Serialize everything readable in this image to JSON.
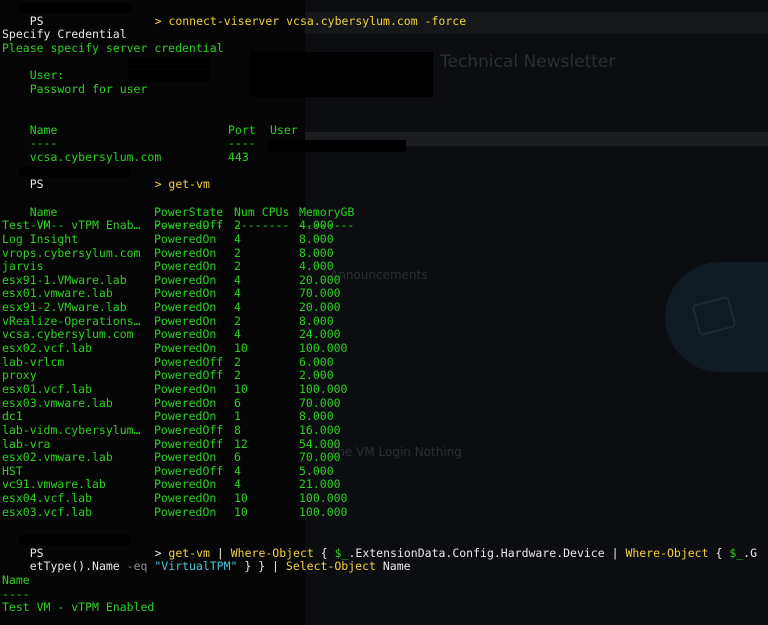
{
  "prompt": "PS",
  "cmd1": "> connect-viserver vcsa.cybersylum.com -force",
  "credential": {
    "header": "Specify Credential",
    "message": "Please specify server credential",
    "user_label": "User:",
    "password_label": "Password for user"
  },
  "connect_table": {
    "headers": {
      "name": "Name",
      "port": "Port",
      "user": "User"
    },
    "dashes": {
      "name": "----",
      "port": "----",
      "user": "----"
    },
    "row": {
      "name": "vcsa.cybersylum.com",
      "port": "443"
    }
  },
  "cmd2": "> get-vm",
  "vm_table": {
    "headers": {
      "name": "Name",
      "state": "PowerState",
      "cpus": "Num CPUs",
      "mem": "MemoryGB"
    },
    "dashes": {
      "name": "----",
      "state": "----------",
      "cpus": "--------",
      "mem": "--------"
    },
    "rows": [
      {
        "name": "Test VM - vTPM Enab…",
        "state": "PoweredOff",
        "cpus": "2",
        "mem": "4.000"
      },
      {
        "name": "Log Insight",
        "state": "PoweredOn",
        "cpus": "4",
        "mem": "8.000"
      },
      {
        "name": "vrops.cybersylum.com",
        "state": "PoweredOn",
        "cpus": "2",
        "mem": "8.000"
      },
      {
        "name": "jarvis",
        "state": "PoweredOn",
        "cpus": "2",
        "mem": "4.000"
      },
      {
        "name": "esx91-1.VMware.lab",
        "state": "PoweredOn",
        "cpus": "4",
        "mem": "20.000"
      },
      {
        "name": "esx01.vmware.lab",
        "state": "PoweredOn",
        "cpus": "4",
        "mem": "70.000"
      },
      {
        "name": "esx91-2.VMware.lab",
        "state": "PoweredOn",
        "cpus": "4",
        "mem": "20.000"
      },
      {
        "name": "vRealize-Operations…",
        "state": "PoweredOn",
        "cpus": "2",
        "mem": "8.000"
      },
      {
        "name": "vcsa.cybersylum.com",
        "state": "PoweredOn",
        "cpus": "4",
        "mem": "24.000"
      },
      {
        "name": "esx02.vcf.lab",
        "state": "PoweredOn",
        "cpus": "10",
        "mem": "100.000"
      },
      {
        "name": "lab-vrlcm",
        "state": "PoweredOff",
        "cpus": "2",
        "mem": "6.000"
      },
      {
        "name": "proxy",
        "state": "PoweredOff",
        "cpus": "2",
        "mem": "2.000"
      },
      {
        "name": "esx01.vcf.lab",
        "state": "PoweredOn",
        "cpus": "10",
        "mem": "100.000"
      },
      {
        "name": "esx03.vmware.lab",
        "state": "PoweredOn",
        "cpus": "6",
        "mem": "70.000"
      },
      {
        "name": "dc1",
        "state": "PoweredOn",
        "cpus": "1",
        "mem": "8.000"
      },
      {
        "name": "lab-vidm.cybersylum…",
        "state": "PoweredOff",
        "cpus": "8",
        "mem": "16.000"
      },
      {
        "name": "lab-vra",
        "state": "PoweredOff",
        "cpus": "12",
        "mem": "54.000"
      },
      {
        "name": "esx02.vmware.lab",
        "state": "PoweredOn",
        "cpus": "6",
        "mem": "70.000"
      },
      {
        "name": "HST",
        "state": "PoweredOff",
        "cpus": "4",
        "mem": "5.000"
      },
      {
        "name": "vc91.vmware.lab",
        "state": "PoweredOn",
        "cpus": "4",
        "mem": "21.000"
      },
      {
        "name": "esx04.vcf.lab",
        "state": "PoweredOn",
        "cpus": "10",
        "mem": "100.000"
      },
      {
        "name": "esx03.vcf.lab",
        "state": "PoweredOn",
        "cpus": "10",
        "mem": "100.000"
      }
    ]
  },
  "cmd3": {
    "gt": "> ",
    "get_vm": "get-vm",
    "pipe1": " | ",
    "where1": "Where-Object",
    "brace1": " { ",
    "var1": "$_",
    "path1": ".ExtensionData.Config.Hardware.Device | ",
    "where2": "Where-Object",
    "brace2": " { ",
    "var2": "$_",
    "tail1": ".G",
    "cont": "etType().Name ",
    "op": "-eq",
    "str": " \"VirtualTPM\"",
    "close": " } } | ",
    "select": "Select-Object",
    "arg": " Name"
  },
  "result": {
    "header": "Name",
    "dashes": "----",
    "value": "Test VM - vTPM Enabled"
  },
  "ghost_text": {
    "title": "Technical Newsletter",
    "section1": "Announcements",
    "section2": "The VM Login Nothing"
  }
}
